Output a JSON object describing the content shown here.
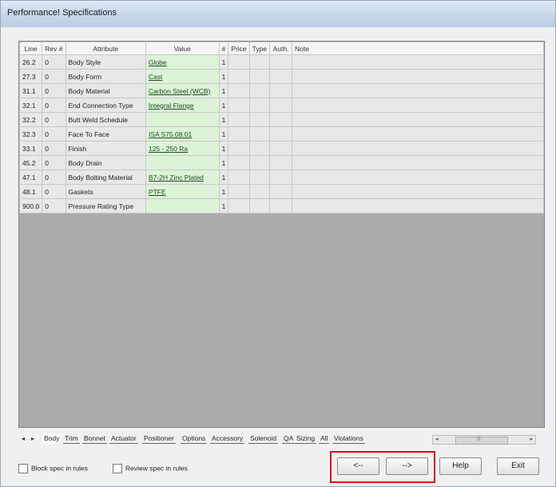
{
  "window": {
    "title": "Performance! Specifications"
  },
  "grid": {
    "columns": [
      "Line",
      "Rev #",
      "Attribute",
      "Value",
      "#",
      "Price",
      "Type",
      "Auth.",
      "Note"
    ],
    "rows": [
      {
        "line": "26.2",
        "rev": "0",
        "attribute": "Body Style",
        "value": "Globe",
        "count": "1"
      },
      {
        "line": "27.3",
        "rev": "0",
        "attribute": "Body Form",
        "value": "Cast",
        "count": "1"
      },
      {
        "line": "31.1",
        "rev": "0",
        "attribute": "Body Material",
        "value": "Carbon Steel (WCB)",
        "count": "1"
      },
      {
        "line": "32.1",
        "rev": "0",
        "attribute": "End Connection Type",
        "value": "Integral Flange",
        "count": "1"
      },
      {
        "line": "32.2",
        "rev": "0",
        "attribute": "Butt Weld Schedule",
        "value": "",
        "count": "1"
      },
      {
        "line": "32.3",
        "rev": "0",
        "attribute": "Face To Face",
        "value": "ISA S75.08.01",
        "count": "1"
      },
      {
        "line": "33.1",
        "rev": "0",
        "attribute": "Finish",
        "value": "125 - 250 Ra",
        "count": "1"
      },
      {
        "line": "45.2",
        "rev": "0",
        "attribute": "Body Drain",
        "value": "",
        "count": "1"
      },
      {
        "line": "47.1",
        "rev": "0",
        "attribute": "Body Bolting Material",
        "value": "B7-2H Zinc Plated",
        "count": "1"
      },
      {
        "line": "48.1",
        "rev": "0",
        "attribute": "Gaskets",
        "value": "PTFE",
        "count": "1"
      },
      {
        "line": "900.0",
        "rev": "0",
        "attribute": "Pressure Rating Type",
        "value": "",
        "count": "1"
      }
    ]
  },
  "tabs": {
    "prev": "◂",
    "next": "▸",
    "items": [
      "Body",
      "Trim",
      "Bonnet",
      "Actuator",
      "Positioner",
      "Options",
      "Accessory",
      "Solenoid",
      "QA",
      "Sizing",
      "All",
      "Violations"
    ]
  },
  "hscroll": {
    "left": "◂",
    "right": "▸",
    "thumb": "|||"
  },
  "footer": {
    "block_spec": "Block spec in rules",
    "review_spec": "Review spec in rules",
    "back": "<--",
    "forward": "-->",
    "help": "Help",
    "exit": "Exit"
  }
}
